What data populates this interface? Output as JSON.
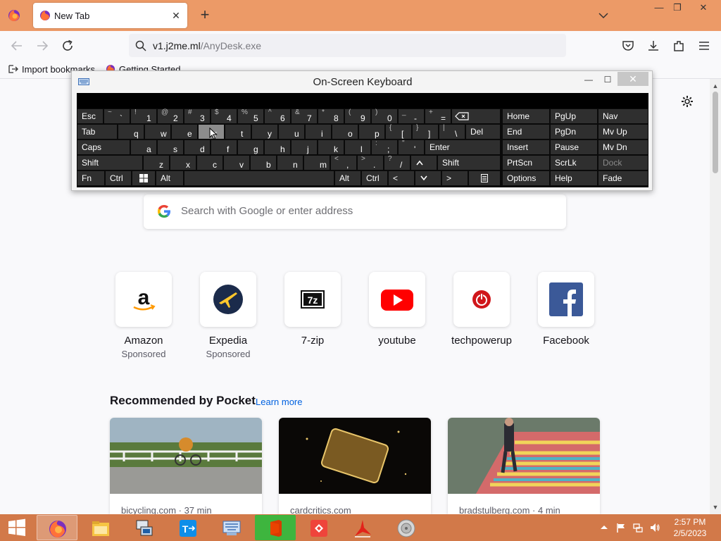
{
  "browser": {
    "tab_title": "New Tab",
    "url_host": "v1.j2me.ml",
    "url_path": "/AnyDesk.exe",
    "bookmarks": [
      {
        "label": "Import bookmarks..."
      },
      {
        "label": "Getting Started"
      }
    ]
  },
  "newtab": {
    "search_placeholder": "Search with Google or enter address",
    "top_sites": [
      {
        "name": "Amazon",
        "sponsored": "Sponsored",
        "icon": "amazon-icon"
      },
      {
        "name": "Expedia",
        "sponsored": "Sponsored",
        "icon": "expedia-icon"
      },
      {
        "name": "7-zip",
        "sponsored": "",
        "icon": "7zip-icon"
      },
      {
        "name": "youtube",
        "sponsored": "",
        "icon": "youtube-icon"
      },
      {
        "name": "techpowerup",
        "sponsored": "",
        "icon": "techpowerup-icon"
      },
      {
        "name": "Facebook",
        "sponsored": "",
        "icon": "facebook-icon"
      }
    ],
    "pocket_heading": "Recommended by Pocket",
    "pocket_link": "Learn more",
    "pocket_cards": [
      {
        "source": "bicycling.com · 37 min"
      },
      {
        "source": "cardcritics.com"
      },
      {
        "source": "bradstulberg.com · 4 min"
      }
    ]
  },
  "osk": {
    "title": "On-Screen Keyboard",
    "keys": {
      "esc": "Esc",
      "tab": "Tab",
      "caps": "Caps",
      "shift": "Shift",
      "shift_r": "Shift",
      "fn": "Fn",
      "ctrl": "Ctrl",
      "alt": "Alt",
      "alt_r": "Alt",
      "ctrl_r": "Ctrl",
      "del": "Del",
      "enter": "Enter",
      "home": "Home",
      "pgup": "PgUp",
      "nav": "Nav",
      "end": "End",
      "pgdn": "PgDn",
      "mvup": "Mv Up",
      "insert": "Insert",
      "pause": "Pause",
      "mvdn": "Mv Dn",
      "prtscn": "PrtScn",
      "scrlk": "ScrLk",
      "dock": "Dock",
      "options": "Options",
      "help": "Help",
      "fade": "Fade",
      "lt": "<",
      "gt": ">",
      "num": [
        {
          "shift": "~",
          "main": "`"
        },
        {
          "shift": "!",
          "main": "1"
        },
        {
          "shift": "@",
          "main": "2"
        },
        {
          "shift": "#",
          "main": "3"
        },
        {
          "shift": "$",
          "main": "4"
        },
        {
          "shift": "%",
          "main": "5"
        },
        {
          "shift": "^",
          "main": "6"
        },
        {
          "shift": "&",
          "main": "7"
        },
        {
          "shift": "*",
          "main": "8"
        },
        {
          "shift": "(",
          "main": "9"
        },
        {
          "shift": ")",
          "main": "0"
        },
        {
          "shift": "_",
          "main": "-"
        },
        {
          "shift": "+",
          "main": "="
        }
      ],
      "row_q": [
        "q",
        "w",
        "e",
        "r",
        "t",
        "y",
        "u",
        "i",
        "o",
        "p"
      ],
      "row_q_sym": [
        {
          "shift": "{",
          "main": "["
        },
        {
          "shift": "}",
          "main": "]"
        },
        {
          "shift": "|",
          "main": "\\"
        }
      ],
      "row_a": [
        "a",
        "s",
        "d",
        "f",
        "g",
        "h",
        "j",
        "k",
        "l"
      ],
      "row_a_sym": [
        {
          "shift": ":",
          "main": ";"
        },
        {
          "shift": "\"",
          "main": "'"
        }
      ],
      "row_z": [
        "z",
        "x",
        "c",
        "v",
        "b",
        "n",
        "m"
      ],
      "row_z_sym": [
        {
          "shift": "<",
          "main": ","
        },
        {
          "shift": ">",
          "main": "."
        },
        {
          "shift": "?",
          "main": "/"
        }
      ],
      "highlighted": "r"
    }
  },
  "taskbar": {
    "time": "2:57 PM",
    "date": "2/5/2023",
    "apps": [
      "firefox-icon",
      "file-explorer-icon",
      "remote-desktop-icon",
      "teamviewer-icon",
      "on-screen-keyboard-icon",
      "office-icon",
      "anydesk-icon",
      "acrobat-icon",
      "media-icon"
    ]
  },
  "colors": {
    "titlebar": "#ec9a67",
    "taskbar": "#d27949",
    "link": "#0061e0"
  }
}
